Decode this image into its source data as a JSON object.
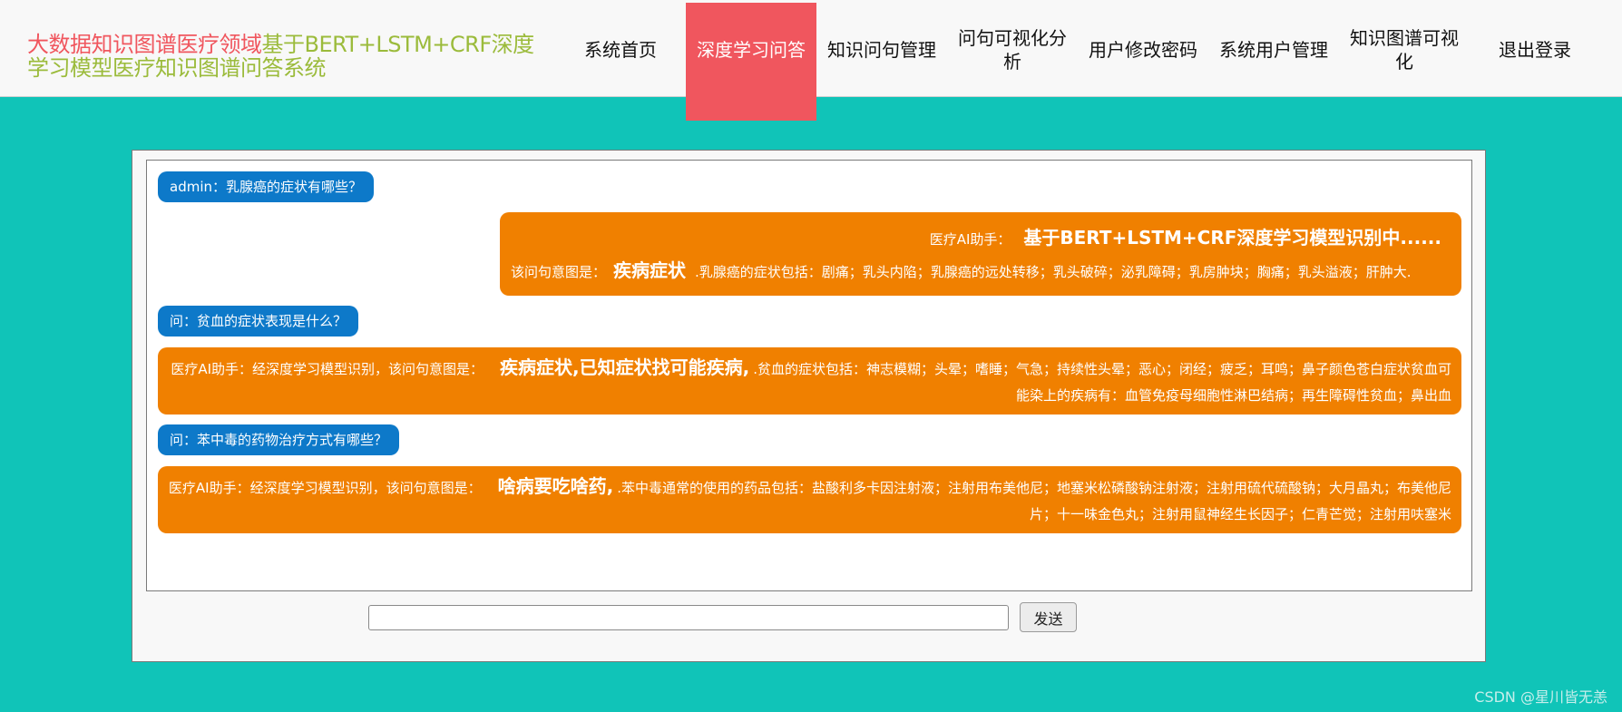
{
  "brand": {
    "part1": "大数据知识图谱医疗领域",
    "part2": "基于BERT+LSTM+CRF深度学习模型医疗知识图谱问答系统"
  },
  "nav": [
    {
      "label": "系统首页",
      "active": false
    },
    {
      "label": "深度学习问答",
      "active": true
    },
    {
      "label": "知识问句管理",
      "active": false
    },
    {
      "label": "问句可视化分析",
      "active": false
    },
    {
      "label": "用户修改密码",
      "active": false
    },
    {
      "label": "系统用户管理",
      "active": false
    },
    {
      "label": "知识图谱可视化",
      "active": false
    },
    {
      "label": "退出登录",
      "active": false
    }
  ],
  "chat": {
    "q1": "admin：乳腺癌的症状有哪些？",
    "a1": {
      "assistant_prefix": "医疗AI助手：",
      "status": "基于BERT+LSTM+CRF深度学习模型识别中......",
      "intent_prefix": "该问句意图是：",
      "intent": "疾病症状",
      "answer": ".乳腺癌的症状包括：剧痛；乳头内陷；乳腺癌的远处转移；乳头破碎；泌乳障碍；乳房肿块；胸痛；乳头溢液；肝肿大."
    },
    "q2": "问：贫血的症状表现是什么？",
    "a2": {
      "prefix": "医疗AI助手：经深度学习模型识别，该问句意图是：",
      "intent": "疾病症状,已知症状找可能疾病,",
      "answer": ".贫血的症状包括：神志模糊；头晕；嗜睡；气急；持续性头晕；恶心；闭经；疲乏；耳鸣；鼻子颜色苍白症状贫血可能染上的疾病有：血管免疫母细胞性淋巴结病；再生障碍性贫血；鼻出血"
    },
    "q3": "问：苯中毒的药物治疗方式有哪些？",
    "a3": {
      "prefix": "医疗AI助手：经深度学习模型识别，该问句意图是：",
      "intent": "啥病要吃啥药,",
      "answer": ".苯中毒通常的使用的药品包括：盐酸利多卡因注射液；注射用布美他尼；地塞米松磷酸钠注射液；注射用硫代硫酸钠；大月晶丸；布美他尼片；十一味金色丸；注射用鼠神经生长因子；仁青芒觉；注射用呋塞米"
    }
  },
  "input": {
    "value": "",
    "placeholder": ""
  },
  "send_label": "发送",
  "watermark": "CSDN @星川皆无恙",
  "colors": {
    "background": "#10c4b8",
    "nav_active": "#f0565e",
    "question_bubble": "#0d79c9",
    "answer_bubble": "#f08000",
    "brand_red": "#f0565e",
    "brand_green": "#9bbb3b"
  }
}
